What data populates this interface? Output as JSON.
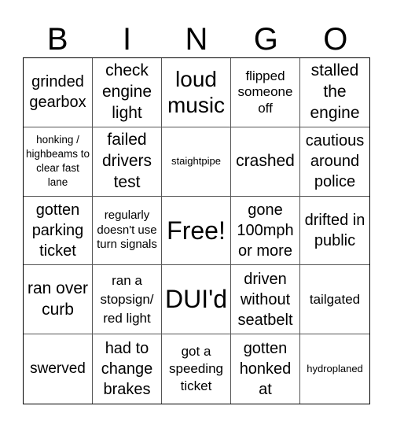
{
  "header": {
    "letters": [
      "B",
      "I",
      "N",
      "G",
      "O"
    ]
  },
  "cells": [
    "grinded gearbox",
    "check engine light",
    "loud music",
    "flipped someone off",
    "stalled the engine",
    "honking / highbeams to clear fast lane",
    "failed drivers test",
    "staightpipe",
    "crashed",
    "cautious around police",
    "gotten parking ticket",
    "regularly doesn't use turn signals",
    "Free!",
    "gone 100mph or more",
    "drifted in public",
    "ran over curb",
    "ran a stopsign/ red light",
    "DUI'd",
    "driven without seatbelt",
    "tailgated",
    "swerved",
    "had to change brakes",
    "got a speeding ticket",
    "gotten honked at",
    "hydroplaned"
  ]
}
